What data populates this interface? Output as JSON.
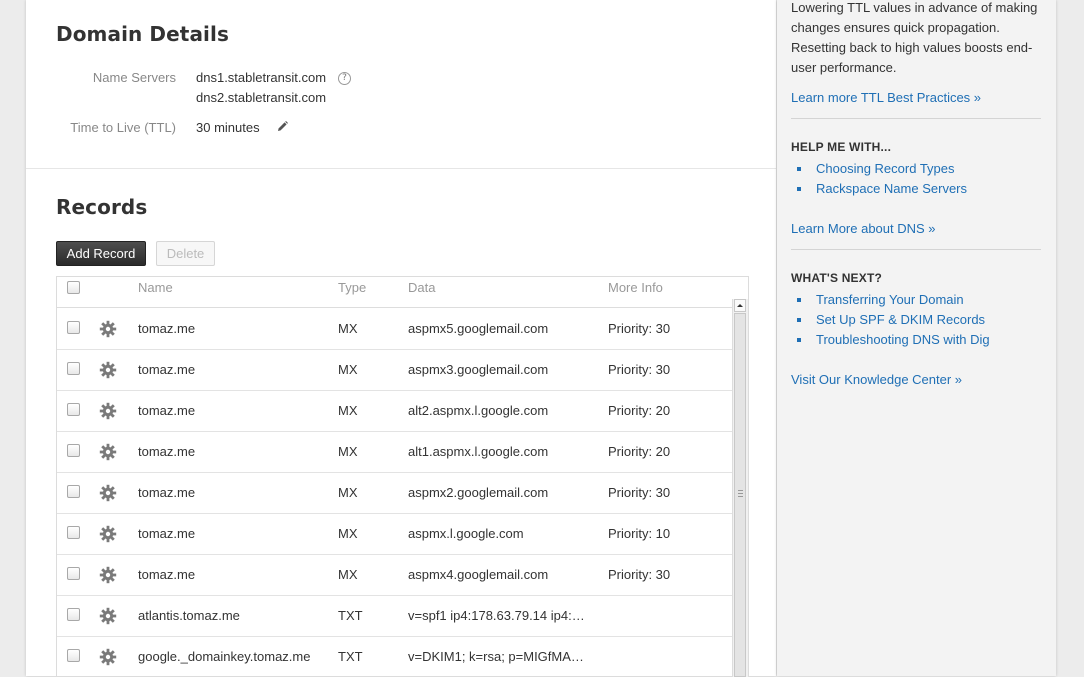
{
  "domain_details": {
    "title": "Domain Details",
    "name_servers_label": "Name Servers",
    "name_servers": [
      "dns1.stabletransit.com",
      "dns2.stabletransit.com"
    ],
    "help_icon": "?",
    "ttl_label": "Time to Live (TTL)",
    "ttl_value": "30 minutes"
  },
  "records": {
    "title": "Records",
    "add_button": "Add Record",
    "delete_button": "Delete",
    "columns": {
      "name": "Name",
      "type": "Type",
      "data": "Data",
      "more_info": "More Info"
    },
    "rows": [
      {
        "name": "tomaz.me",
        "type": "MX",
        "data": "aspmx5.googlemail.com",
        "info": "Priority: 30"
      },
      {
        "name": "tomaz.me",
        "type": "MX",
        "data": "aspmx3.googlemail.com",
        "info": "Priority: 30"
      },
      {
        "name": "tomaz.me",
        "type": "MX",
        "data": "alt2.aspmx.l.google.com",
        "info": "Priority: 20"
      },
      {
        "name": "tomaz.me",
        "type": "MX",
        "data": "alt1.aspmx.l.google.com",
        "info": "Priority: 20"
      },
      {
        "name": "tomaz.me",
        "type": "MX",
        "data": "aspmx2.googlemail.com",
        "info": "Priority: 30"
      },
      {
        "name": "tomaz.me",
        "type": "MX",
        "data": "aspmx.l.google.com",
        "info": "Priority: 10"
      },
      {
        "name": "tomaz.me",
        "type": "MX",
        "data": "aspmx4.googlemail.com",
        "info": "Priority: 30"
      },
      {
        "name": "atlantis.tomaz.me",
        "type": "TXT",
        "data": "v=spf1 ip4:178.63.79.14 ip4:…",
        "info": ""
      },
      {
        "name": "google._domainkey.tomaz.me",
        "type": "TXT",
        "data": "v=DKIM1; k=rsa; p=MIGfMA…",
        "info": ""
      }
    ]
  },
  "sidebar": {
    "ttl_text_lines": [
      "Lowering TTL values in advance of making",
      "changes ensures quick propagation.",
      "Resetting back to high values boosts end-",
      "user performance."
    ],
    "ttl_link": "Learn more TTL Best Practices »",
    "help_heading": "HELP ME WITH...",
    "help_links": [
      "Choosing Record Types",
      "Rackspace Name Servers"
    ],
    "dns_link": "Learn More about DNS »",
    "next_heading": "WHAT'S NEXT?",
    "next_links": [
      "Transferring Your Domain",
      "Set Up SPF & DKIM Records",
      "Troubleshooting DNS with Dig"
    ],
    "knowledge_link": "Visit Our Knowledge Center »"
  },
  "colors": {
    "link": "#1f6fb5",
    "primary_button": "#333333"
  }
}
